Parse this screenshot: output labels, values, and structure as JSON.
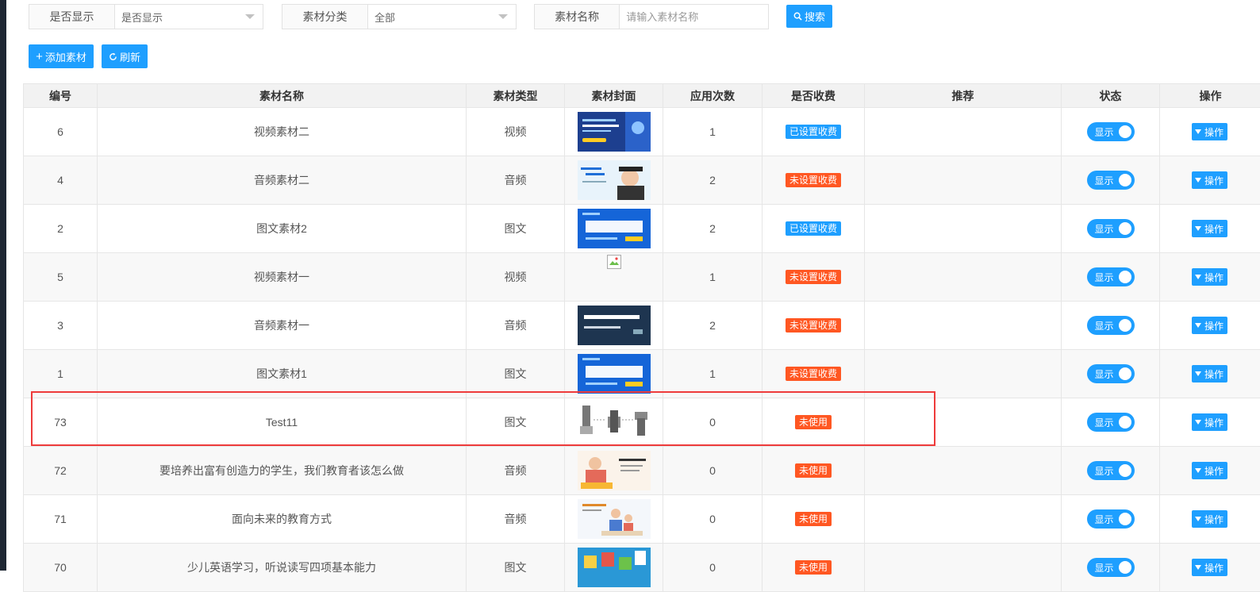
{
  "filters": {
    "display": {
      "label": "是否显示",
      "value": "是否显示"
    },
    "category": {
      "label": "素材分类",
      "value": "全部"
    },
    "name": {
      "label": "素材名称",
      "placeholder": "请输入素材名称"
    },
    "search_label": "搜索"
  },
  "toolbar": {
    "add_label": "添加素材",
    "refresh_label": "刷新"
  },
  "table": {
    "headers": [
      "编号",
      "素材名称",
      "素材类型",
      "素材封面",
      "应用次数",
      "是否收费",
      "推荐",
      "状态",
      "操作"
    ],
    "rows": [
      {
        "id": "6",
        "name": "视频素材二",
        "type": "视频",
        "cover": "video-cover",
        "count": "1",
        "fee": "已设置收费",
        "fee_color": "#1e9fff",
        "status": "显示",
        "op": "操作"
      },
      {
        "id": "4",
        "name": "音频素材二",
        "type": "音频",
        "cover": "graduate-cover",
        "count": "2",
        "fee": "未设置收费",
        "fee_color": "#ff5722",
        "status": "显示",
        "op": "操作"
      },
      {
        "id": "2",
        "name": "图文素材2",
        "type": "图文",
        "cover": "classroom-cover",
        "count": "2",
        "fee": "已设置收费",
        "fee_color": "#1e9fff",
        "status": "显示",
        "op": "操作"
      },
      {
        "id": "5",
        "name": "视频素材一",
        "type": "视频",
        "cover": "broken-image",
        "count": "1",
        "fee": "未设置收费",
        "fee_color": "#ff5722",
        "status": "显示",
        "op": "操作"
      },
      {
        "id": "3",
        "name": "音频素材一",
        "type": "音频",
        "cover": "ui-designer-cover",
        "count": "2",
        "fee": "未设置收费",
        "fee_color": "#ff5722",
        "status": "显示",
        "op": "操作"
      },
      {
        "id": "1",
        "name": "图文素材1",
        "type": "图文",
        "cover": "classroom-cover",
        "count": "1",
        "fee": "未设置收费",
        "fee_color": "#ff5722",
        "status": "显示",
        "op": "操作"
      },
      {
        "id": "73",
        "name": "Test11",
        "type": "图文",
        "cover": "bolts-cover",
        "count": "0",
        "fee": "未使用",
        "fee_color": "#ff5722",
        "status": "显示",
        "op": "操作"
      },
      {
        "id": "72",
        "name": "要培养出富有创造力的学生，我们教育者该怎么做",
        "type": "音频",
        "cover": "kids-cover",
        "count": "0",
        "fee": "未使用",
        "fee_color": "#ff5722",
        "status": "显示",
        "op": "操作"
      },
      {
        "id": "71",
        "name": "面向未来的教育方式",
        "type": "音频",
        "cover": "family-cover",
        "count": "0",
        "fee": "未使用",
        "fee_color": "#ff5722",
        "status": "显示",
        "op": "操作"
      },
      {
        "id": "70",
        "name": "少儿英语学习，听说读写四项基本能力",
        "type": "图文",
        "cover": "letters-cover",
        "count": "0",
        "fee": "未使用",
        "fee_color": "#ff5722",
        "status": "显示",
        "op": "操作"
      }
    ]
  },
  "highlight_color": "#ee3b3b"
}
